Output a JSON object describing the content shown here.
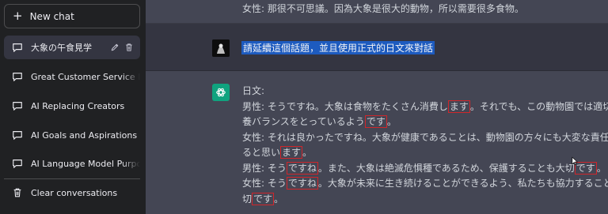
{
  "sidebar": {
    "new_chat_label": "New chat",
    "items": [
      {
        "label": "大象の午食見学"
      },
      {
        "label": "Great Customer Service Defi"
      },
      {
        "label": "AI Replacing Creators"
      },
      {
        "label": "AI Goals and Aspirations"
      },
      {
        "label": "AI Language Model Purpose"
      }
    ],
    "clear_label": "Clear conversations"
  },
  "conversation": {
    "top_text": "女性: 那很不可思議。因為大象是很大的動物，所以需要很多食物。",
    "user_message": "請延續這個話題，並且使用正式的日文來對話",
    "bot_lines": [
      [
        "日文:"
      ],
      [
        "男性: そうですね。大象は食物をたくさん消費し",
        "ます",
        "。それでも、この動物園では適切な栄"
      ],
      [
        "養バランスをとっているよう",
        "です",
        "。"
      ],
      [
        "女性: それは良かったですね。大象が健康であることは、動物園の方々にも大変な責任があ"
      ],
      [
        "ると思い",
        "ます",
        "。"
      ],
      [
        "男性: そう",
        "ですね",
        "。また、大象は絶滅危惧種であるため、保護することも大切",
        "です",
        "。"
      ],
      [
        "女性: そう",
        "ですね",
        "。大象が未来に生き続けることができるよう、私たちも協力することが大"
      ],
      [
        "切",
        "です",
        "。"
      ]
    ]
  },
  "colors": {
    "sidebar_bg": "#202123",
    "user_row_bg": "#343541",
    "bot_row_bg": "#444654",
    "highlight": "#1d5bbf",
    "annotation_box": "#d0262b",
    "bot_avatar": "#10a37f"
  },
  "icons": {
    "new_chat": "plus-icon",
    "chat_item": "message-icon",
    "edit": "pencil-icon",
    "delete": "trash-icon",
    "clear": "trash-icon",
    "bot": "openai-logo-icon"
  }
}
